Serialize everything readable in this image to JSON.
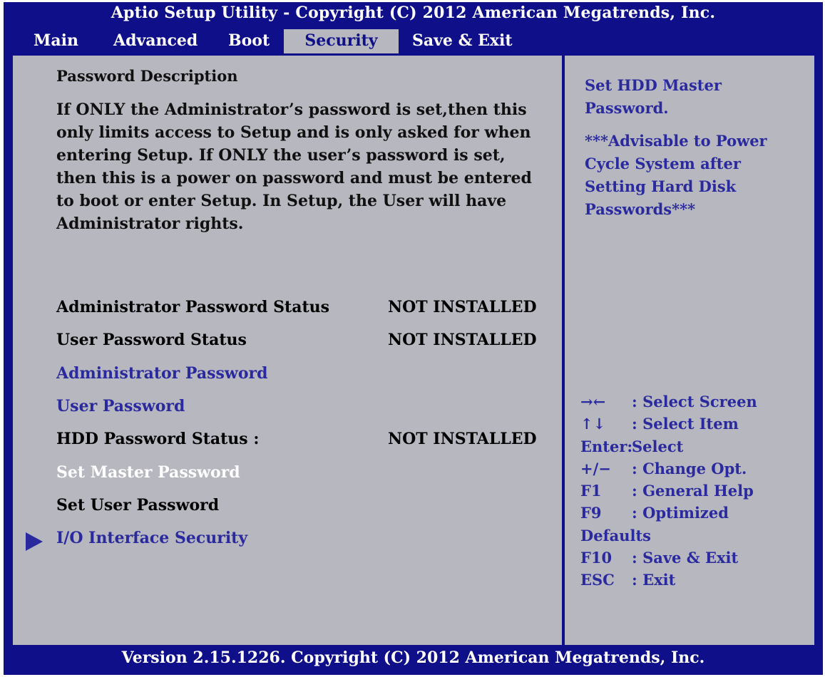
{
  "header": {
    "title": "Aptio Setup Utility - Copyright (C) 2012 American Megatrends, Inc."
  },
  "tabs": [
    {
      "label": "Main"
    },
    {
      "label": "Advanced"
    },
    {
      "label": "Boot"
    },
    {
      "label": "Security"
    },
    {
      "label": "Save & Exit"
    }
  ],
  "active_tab": "Security",
  "description": {
    "heading": "Password Description",
    "body": "If ONLY the Administrator’s password is set,then this only limits access to Setup and is only asked for when entering Setup. If ONLY the user’s password is set, then this is a power on password and must be entered to boot or enter Setup. In Setup, the User will have Administrator rights."
  },
  "items": {
    "admin_status": {
      "label": "Administrator Password Status",
      "value": "NOT INSTALLED"
    },
    "user_status": {
      "label": "User Password Status",
      "value": "NOT INSTALLED"
    },
    "admin_password": {
      "label": "Administrator Password"
    },
    "user_password": {
      "label": "User Password"
    },
    "hdd_status": {
      "label": "HDD Password Status :",
      "value": "NOT INSTALLED"
    },
    "set_master": {
      "label": "Set Master Password"
    },
    "set_user": {
      "label": "Set User Password"
    },
    "io_security": {
      "label": "I/O Interface Security"
    }
  },
  "help": {
    "line1": "Set HDD Master Password.",
    "line2": "***Advisable to Power Cycle System after Setting Hard Disk Passwords***"
  },
  "keys": [
    {
      "key": "→←",
      "desc": ": Select Screen"
    },
    {
      "key": "↑↓",
      "desc": ": Select Item"
    },
    {
      "key": "Enter:",
      "desc": "Select"
    },
    {
      "key": "+/−",
      "desc": ": Change Opt."
    },
    {
      "key": "F1",
      "desc": ": General Help"
    },
    {
      "key": "F9",
      "desc": ": Optimized"
    },
    {
      "key": "Defaults",
      "desc": ""
    },
    {
      "key": "F10",
      "desc": ": Save & Exit"
    },
    {
      "key": "ESC",
      "desc": ": Exit"
    }
  ],
  "footer": "Version 2.15.1226. Copyright (C) 2012 American Megatrends, Inc.",
  "colors": {
    "background": "#0f0f8a",
    "panel": "#b7b7c0",
    "selectable": "#2a2a9e",
    "highlight": "#ffffff"
  }
}
